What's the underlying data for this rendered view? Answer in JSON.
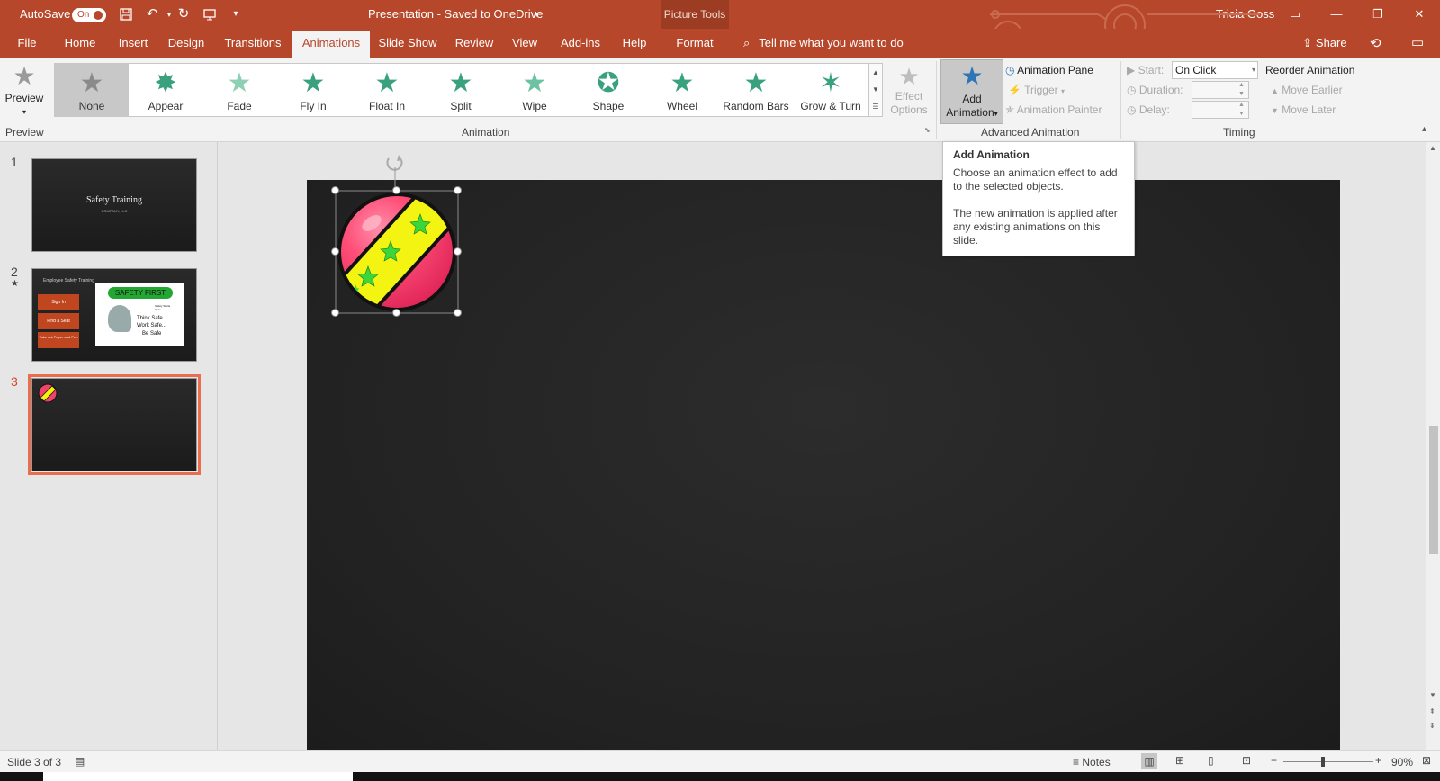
{
  "titlebar": {
    "autosave_label": "AutoSave",
    "autosave_state": "On",
    "doc_title": "Presentation - Saved to OneDrive",
    "contextual_group": "Picture Tools",
    "user": "Tricia Goss",
    "accent_color": "#b7472a"
  },
  "tabs": [
    "File",
    "Home",
    "Insert",
    "Design",
    "Transitions",
    "Animations",
    "Slide Show",
    "Review",
    "View",
    "Add-ins",
    "Help",
    "Format"
  ],
  "active_tab": "Animations",
  "tell_me": "Tell me what you want to do",
  "share": "Share",
  "ribbon": {
    "preview": {
      "button": "Preview",
      "group": "Preview"
    },
    "animation": {
      "group": "Animation",
      "gallery": [
        "None",
        "Appear",
        "Fade",
        "Fly In",
        "Float In",
        "Split",
        "Wipe",
        "Shape",
        "Wheel",
        "Random Bars",
        "Grow & Turn"
      ],
      "selected": "None",
      "effect_options_line1": "Effect",
      "effect_options_line2": "Options"
    },
    "advanced": {
      "group": "Advanced Animation",
      "add_line1": "Add",
      "add_line2": "Animation",
      "pane": "Animation Pane",
      "trigger": "Trigger",
      "painter": "Animation Painter"
    },
    "timing": {
      "group": "Timing",
      "start_label": "Start:",
      "start_value": "On Click",
      "duration_label": "Duration:",
      "delay_label": "Delay:",
      "reorder": "Reorder Animation",
      "move_earlier": "Move Earlier",
      "move_later": "Move Later"
    }
  },
  "tooltip": {
    "title": "Add Animation",
    "line1": "Choose an animation effect to add to the selected objects.",
    "line2": "The new animation is applied after any existing animations on this slide."
  },
  "slides": [
    {
      "number": "1",
      "title": "Safety Training",
      "subtitle": "COMPANY, LLC"
    },
    {
      "number": "2",
      "star": "★",
      "heading": "Employee Safety Training",
      "box1": "Sign In",
      "box2": "Find a Seat",
      "box3": "Take out Paper and Pen",
      "banner": "SAFETY FIRST",
      "slogan_small": "Safety Starts Here",
      "slogan1": "Think Safe...",
      "slogan2": "Work Safe...",
      "slogan3": "Be Safe"
    },
    {
      "number": "3"
    }
  ],
  "statusbar": {
    "slide_info": "Slide 3 of 3",
    "notes": "Notes",
    "zoom": "90%"
  }
}
